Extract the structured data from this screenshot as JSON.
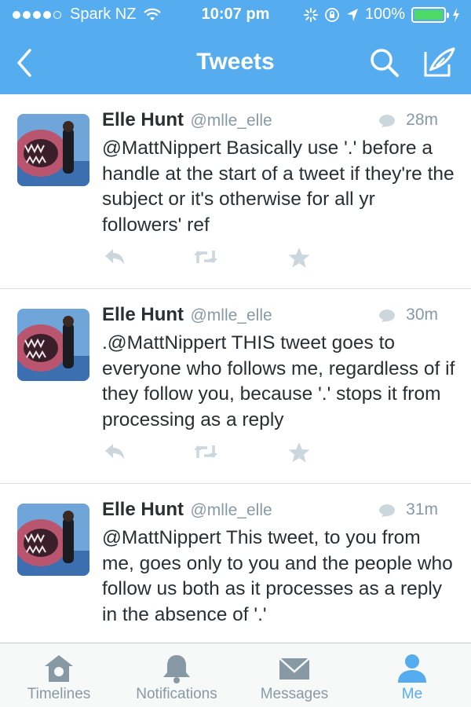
{
  "status_bar": {
    "carrier": "Spark NZ",
    "time": "10:07 pm",
    "battery": "100%"
  },
  "nav": {
    "title": "Tweets"
  },
  "tweets": [
    {
      "name": "Elle Hunt",
      "handle": "@mlle_elle",
      "age": "28m",
      "text": "@MattNippert Basically use '.' before a handle at the start of a tweet if they're the subject or it's otherwise for all yr followers' ref"
    },
    {
      "name": "Elle Hunt",
      "handle": "@mlle_elle",
      "age": "30m",
      "text": ".@MattNippert THIS tweet goes to everyone who follows me, regardless of if they follow you, because '.' stops it from processing as a reply"
    },
    {
      "name": "Elle Hunt",
      "handle": "@mlle_elle",
      "age": "31m",
      "text": "@MattNippert This tweet, to you from me, goes only to you and the people who follow us both as it processes as a reply in the absence of '.'"
    }
  ],
  "tab_bar": {
    "tabs": [
      {
        "label": "Timelines",
        "icon": "home-icon"
      },
      {
        "label": "Notifications",
        "icon": "bell-icon"
      },
      {
        "label": "Messages",
        "icon": "envelope-icon"
      },
      {
        "label": "Me",
        "icon": "person-icon",
        "active": true
      }
    ]
  },
  "colors": {
    "brand_blue": "#55acee",
    "grey_text": "#8899a6",
    "icon_grey": "#ccd6dd",
    "battery_green": "#4cd964"
  }
}
